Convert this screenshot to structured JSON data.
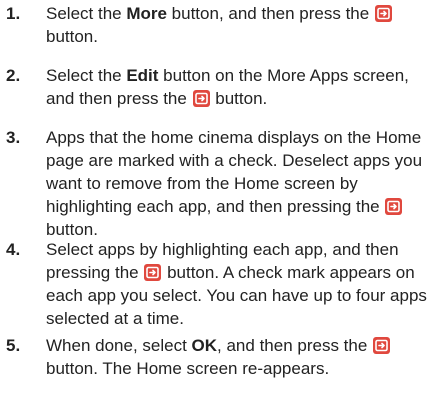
{
  "colors": {
    "text": "#222222",
    "button_icon": "#e0483e"
  },
  "icon": "enter-button-icon",
  "steps": [
    {
      "number": "1.",
      "parts": [
        {
          "t": "Select the "
        },
        {
          "b": "More"
        },
        {
          "t": " button, and then press the "
        },
        {
          "icon": true
        },
        {
          "t": " button."
        }
      ]
    },
    {
      "number": "2.",
      "parts": [
        {
          "t": "Select the "
        },
        {
          "b": "Edit"
        },
        {
          "t": " button on the More Apps screen, and then press the "
        },
        {
          "icon": true
        },
        {
          "t": " button."
        }
      ]
    },
    {
      "number": "3.",
      "parts": [
        {
          "t": "Apps that the home cinema displays on the Home page are marked with a check. Deselect apps you want to remove from the Home screen by highlighting each app, and then pressing the "
        },
        {
          "icon": true
        },
        {
          "t": " button."
        }
      ]
    },
    {
      "number": "4.",
      "parts": [
        {
          "t": "Select apps by highlighting each app, and then pressing the "
        },
        {
          "icon": true
        },
        {
          "t": " button. A check mark appears on each app you select. You can have up to four apps selected at a time."
        }
      ]
    },
    {
      "number": "5.",
      "parts": [
        {
          "t": "When done, select "
        },
        {
          "b": "OK"
        },
        {
          "t": ", and then press the "
        },
        {
          "icon": true
        },
        {
          "t": " button. The Home screen re-appears."
        }
      ]
    }
  ]
}
